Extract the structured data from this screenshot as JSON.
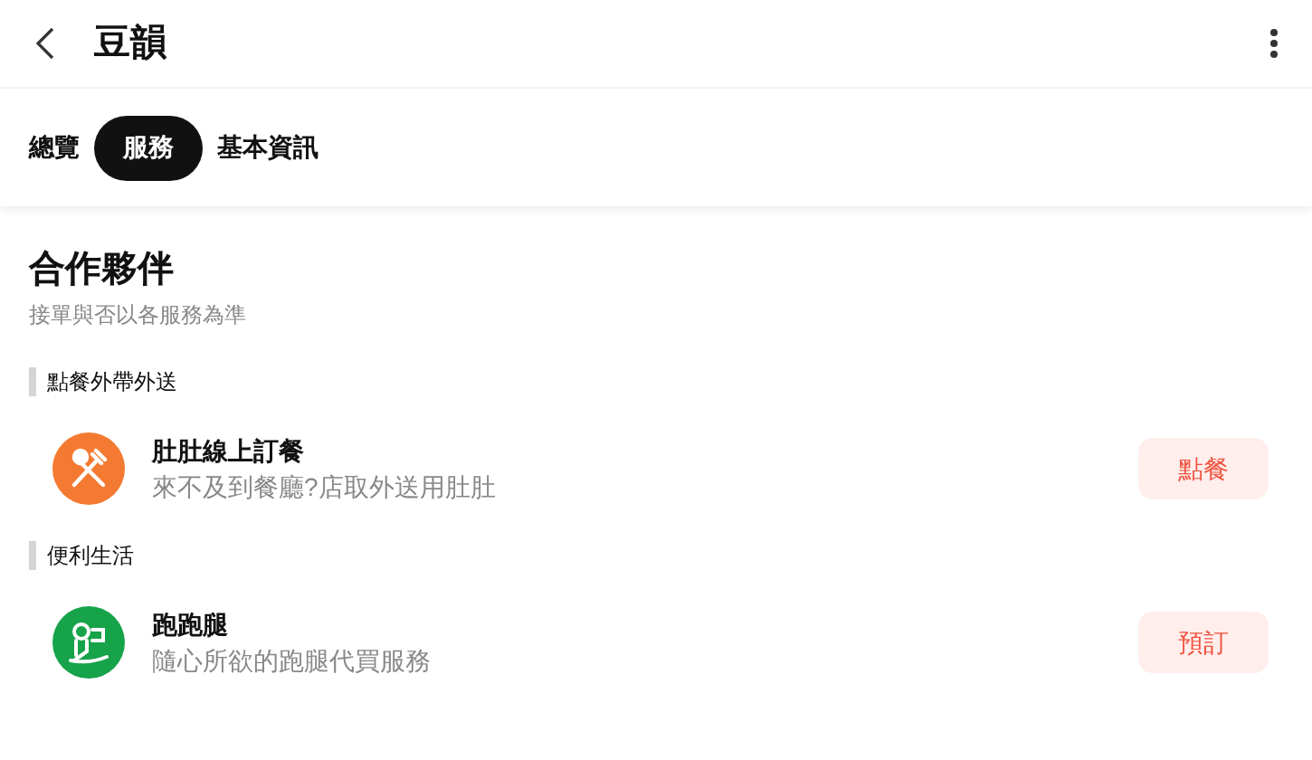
{
  "header": {
    "title": "豆韻"
  },
  "tabs": [
    {
      "label": "總覽",
      "selected": false
    },
    {
      "label": "服務",
      "selected": true
    },
    {
      "label": "基本資訊",
      "selected": false
    }
  ],
  "section": {
    "title": "合作夥伴",
    "subtitle": "接單與否以各服務為準"
  },
  "groups": [
    {
      "title": "點餐外帶外送",
      "items": [
        {
          "kind": "food",
          "color": "#f47a31",
          "name": "肚肚線上訂餐",
          "description": "來不及到餐廳?店取外送用肚肚",
          "action": "點餐"
        }
      ]
    },
    {
      "title": "便利生活",
      "items": [
        {
          "kind": "errand",
          "color": "#16a34a",
          "name": "跑跑腿",
          "description": "隨心所欲的跑腿代買服務",
          "action": "預訂"
        }
      ]
    }
  ]
}
